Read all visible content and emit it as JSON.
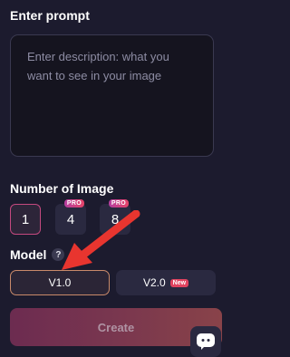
{
  "prompt": {
    "title": "Enter prompt",
    "placeholder": "Enter description: what you want to see in your image",
    "value": ""
  },
  "number_of_image": {
    "title": "Number of Image",
    "options": [
      {
        "label": "1",
        "selected": true
      },
      {
        "label": "4",
        "badge": "PRO"
      },
      {
        "label": "8",
        "badge": "PRO"
      }
    ]
  },
  "model": {
    "title": "Model",
    "help_icon": "?",
    "options": [
      {
        "label": "V1.0",
        "selected": true
      },
      {
        "label": "V2.0",
        "badge": "New"
      }
    ]
  },
  "create_button": {
    "label": "Create",
    "disabled": true
  },
  "colors": {
    "background": "#1c1b2e",
    "accent_pink": "#c4497f",
    "annotation_arrow": "#e8352f"
  },
  "icons": {
    "chat": "chat-bubble-icon",
    "help": "question-circle-icon",
    "annotation": "red-arrow-annotation"
  }
}
